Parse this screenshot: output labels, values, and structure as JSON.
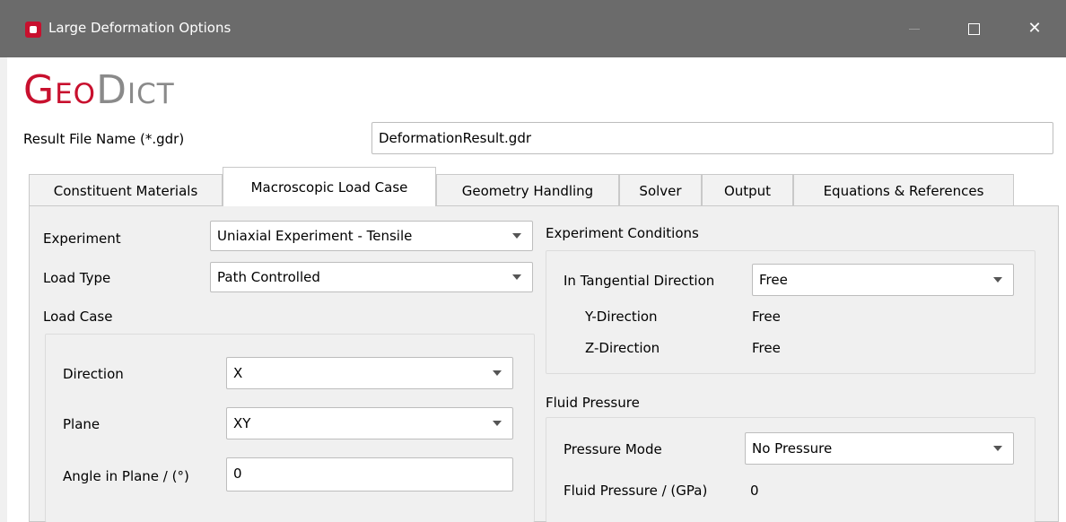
{
  "window": {
    "title": "Large Deformation Options"
  },
  "logo": {
    "geo": "Geo",
    "dict": "Dict"
  },
  "result_file": {
    "label": "Result File Name (*.gdr)",
    "value": "DeformationResult.gdr"
  },
  "tabs": [
    {
      "label": "Constituent Materials"
    },
    {
      "label": "Macroscopic Load Case"
    },
    {
      "label": "Geometry Handling"
    },
    {
      "label": "Solver"
    },
    {
      "label": "Output"
    },
    {
      "label": "Equations & References"
    }
  ],
  "left": {
    "experiment_label": "Experiment",
    "experiment_value": "Uniaxial Experiment - Tensile",
    "load_type_label": "Load Type",
    "load_type_value": "Path Controlled",
    "load_case_label": "Load Case",
    "direction_label": "Direction",
    "direction_value": "X",
    "plane_label": "Plane",
    "plane_value": "XY",
    "angle_label": "Angle in Plane / (°)",
    "angle_value": "0"
  },
  "right": {
    "conditions_label": "Experiment Conditions",
    "tangential_label": "In Tangential Direction",
    "tangential_value": "Free",
    "y_label": "Y-Direction",
    "y_value": "Free",
    "z_label": "Z-Direction",
    "z_value": "Free",
    "fluid_label": "Fluid Pressure",
    "pressure_mode_label": "Pressure Mode",
    "pressure_mode_value": "No Pressure",
    "fluid_pressure_label": "Fluid Pressure / (GPa)",
    "fluid_pressure_value": "0"
  },
  "colors": {
    "titlebar": "#6b6b6b",
    "brand_red": "#c8102e",
    "brand_gray": "#8a8a8a"
  }
}
